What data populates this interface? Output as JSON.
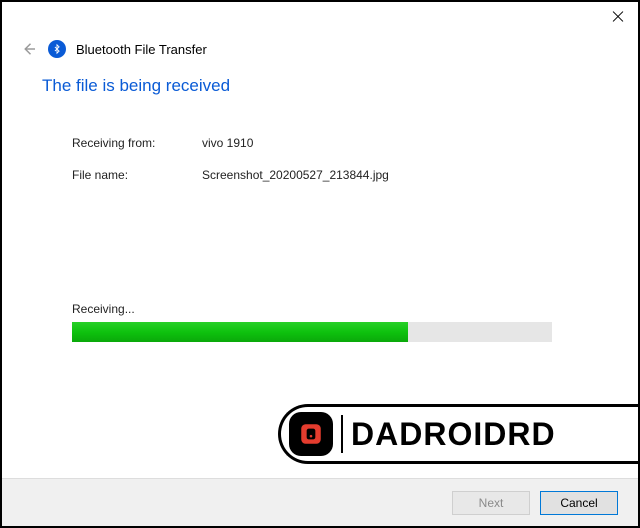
{
  "window": {
    "title": "Bluetooth File Transfer"
  },
  "heading": "The file is being received",
  "fields": {
    "from_label": "Receiving from:",
    "from_value": "vivo 1910",
    "file_label": "File name:",
    "file_value": "Screenshot_20200527_213844.jpg"
  },
  "progress": {
    "label": "Receiving...",
    "percent": 70
  },
  "buttons": {
    "next": "Next",
    "cancel": "Cancel"
  },
  "watermark": {
    "text": "DADROIDRD"
  },
  "colors": {
    "accent": "#0a5bd6",
    "progress": "#0ec20e"
  }
}
